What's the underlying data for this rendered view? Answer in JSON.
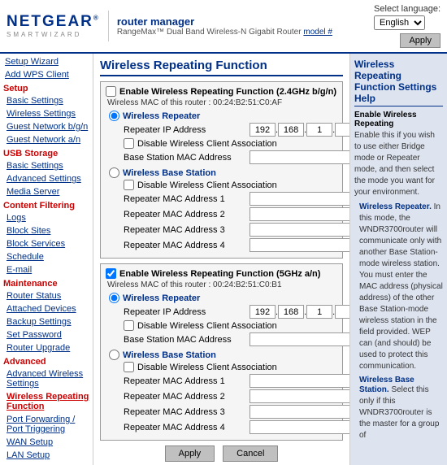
{
  "header": {
    "brand": "NETGEAR",
    "smartwizard": "SMARTWIZARD",
    "router_manager": "router manager",
    "router_model": "RangеMax™ Dual Band Wireless-N Gigabit Router",
    "model_link": "model #",
    "lang_label": "Select language:",
    "lang_value": "English",
    "apply_label": "Apply"
  },
  "sidebar": {
    "setup_section": "Setup",
    "items": [
      {
        "id": "setup-wizard",
        "label": "Setup Wizard"
      },
      {
        "id": "add-wps",
        "label": "Add WPS Client"
      },
      {
        "id": "basic-settings",
        "label": "Basic Settings",
        "section": "Setup"
      },
      {
        "id": "wireless-settings",
        "label": "Wireless Settings"
      },
      {
        "id": "guest-network-bgn",
        "label": "Guest Network b/g/n"
      },
      {
        "id": "guest-network-an",
        "label": "Guest Network a/n"
      },
      {
        "id": "usb-storage",
        "label": "USB Storage",
        "section_title": true
      },
      {
        "id": "basic-settings-usb",
        "label": "Basic Settings"
      },
      {
        "id": "advanced-settings",
        "label": "Advanced Settings"
      },
      {
        "id": "media-server",
        "label": "Media Server"
      },
      {
        "id": "content-filtering",
        "label": "Content Filtering",
        "section_title": true
      },
      {
        "id": "logs",
        "label": "Logs"
      },
      {
        "id": "block-sites",
        "label": "Block Sites"
      },
      {
        "id": "block-services",
        "label": "Block Services"
      },
      {
        "id": "schedule",
        "label": "Schedule"
      },
      {
        "id": "email",
        "label": "E-mail"
      },
      {
        "id": "maintenance",
        "label": "Maintenance",
        "section_title": true
      },
      {
        "id": "router-status",
        "label": "Router Status"
      },
      {
        "id": "attached-devices",
        "label": "Attached Devices"
      },
      {
        "id": "backup-settings",
        "label": "Backup Settings"
      },
      {
        "id": "set-password",
        "label": "Set Password"
      },
      {
        "id": "router-upgrade",
        "label": "Router Upgrade"
      },
      {
        "id": "advanced",
        "label": "Advanced",
        "section_title": true
      },
      {
        "id": "advanced-wireless",
        "label": "Advanced Wireless Settings"
      },
      {
        "id": "wireless-repeating",
        "label": "Wireless Repeating Function",
        "active": true
      },
      {
        "id": "port-forwarding",
        "label": "Port Forwarding / Port Triggering"
      },
      {
        "id": "wan-setup",
        "label": "WAN Setup"
      },
      {
        "id": "lan-setup",
        "label": "LAN Setup"
      }
    ]
  },
  "page": {
    "title": "Wireless Repeating Function",
    "section1": {
      "checkbox_label": "Enable Wireless Repeating Function (2.4GHz b/g/n)",
      "mac_info": "Wireless MAC of this router :  00:24:B2:51:C0:AF",
      "wireless_repeater": {
        "label": "Wireless Repeater",
        "repeater_ip_label": "Repeater IP Address",
        "ip1": "192",
        "ip2": "168",
        "ip3": "1",
        "ip4": "",
        "disable_client_label": "Disable Wireless Client Association",
        "base_station_mac_label": "Base Station MAC Address",
        "base_station_mac_value": ""
      },
      "wireless_base_station": {
        "label": "Wireless Base Station",
        "disable_client_label": "Disable Wireless Client Association",
        "repeater_mac1_label": "Repeater MAC Address 1",
        "repeater_mac2_label": "Repeater MAC Address 2",
        "repeater_mac3_label": "Repeater MAC Address 3",
        "repeater_mac4_label": "Repeater MAC Address 4"
      }
    },
    "section2": {
      "checkbox_label": "Enable Wireless Repeating Function (5GHz a/n)",
      "mac_info": "Wireless MAC of this router :  00:24:B2:51:C0:B1",
      "wireless_repeater": {
        "label": "Wireless Repeater",
        "repeater_ip_label": "Repeater IP Address",
        "ip1": "192",
        "ip2": "168",
        "ip3": "1",
        "ip4": "",
        "disable_client_label": "Disable Wireless Client Association",
        "base_station_mac_label": "Base Station MAC Address",
        "base_station_mac_value": ""
      },
      "wireless_base_station": {
        "label": "Wireless Base Station",
        "disable_client_label": "Disable Wireless Client Association",
        "repeater_mac1_label": "Repeater MAC Address 1",
        "repeater_mac2_label": "Repeater MAC Address 2",
        "repeater_mac3_label": "Repeater MAC Address 3",
        "repeater_mac4_label": "Repeater MAC Address 4"
      }
    },
    "apply_label": "Apply",
    "cancel_label": "Cancel"
  },
  "help": {
    "title": "Wireless Repeating Function Settings Help",
    "enable_title": "Enable Wireless Repeating",
    "enable_text": "Enable this if you wish to use either Bridge mode or Repeater mode, and then select the mode you want for your environment.",
    "bullet1_title": "Wireless Repeater.",
    "bullet1_text": "In this mode, the WNDR3700router will communicate only with another Base Station-mode wireless station. You must enter the MAC address (physical address) of the other Base Station-mode wireless station in the field provided. WEP can (and should) be used to protect this communication.",
    "bullet2_title": "Wireless Base Station.",
    "bullet2_text": "Select this only if this WNDR3700router is the master for a group of"
  }
}
